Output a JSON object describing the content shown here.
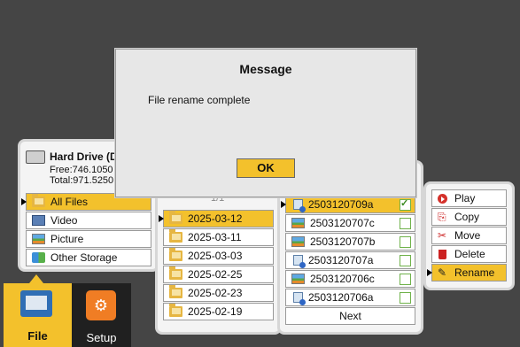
{
  "device": {
    "name": "Hard Drive (D",
    "free": "Free:746.1050",
    "total": "Total:971.5250"
  },
  "categories": [
    "All Files",
    "Video",
    "Picture",
    "Other Storage"
  ],
  "dates": [
    "2025-03-12",
    "2025-03-11",
    "2025-03-03",
    "2025-02-25",
    "2025-02-23",
    "2025-02-19"
  ],
  "folder_partial": "1/1",
  "files": [
    "2503120709a",
    "2503120707c",
    "2503120707b",
    "2503120707a",
    "2503120706c",
    "2503120706a"
  ],
  "next_label": "Next",
  "actions": [
    "Play",
    "Copy",
    "Move",
    "Delete",
    "Rename"
  ],
  "tabs": {
    "file": "File",
    "setup": "Setup"
  },
  "dialog": {
    "title": "Message",
    "message": "File rename complete",
    "ok": "OK"
  },
  "colors": {
    "accent": "#f3c12c",
    "background": "#454545"
  }
}
